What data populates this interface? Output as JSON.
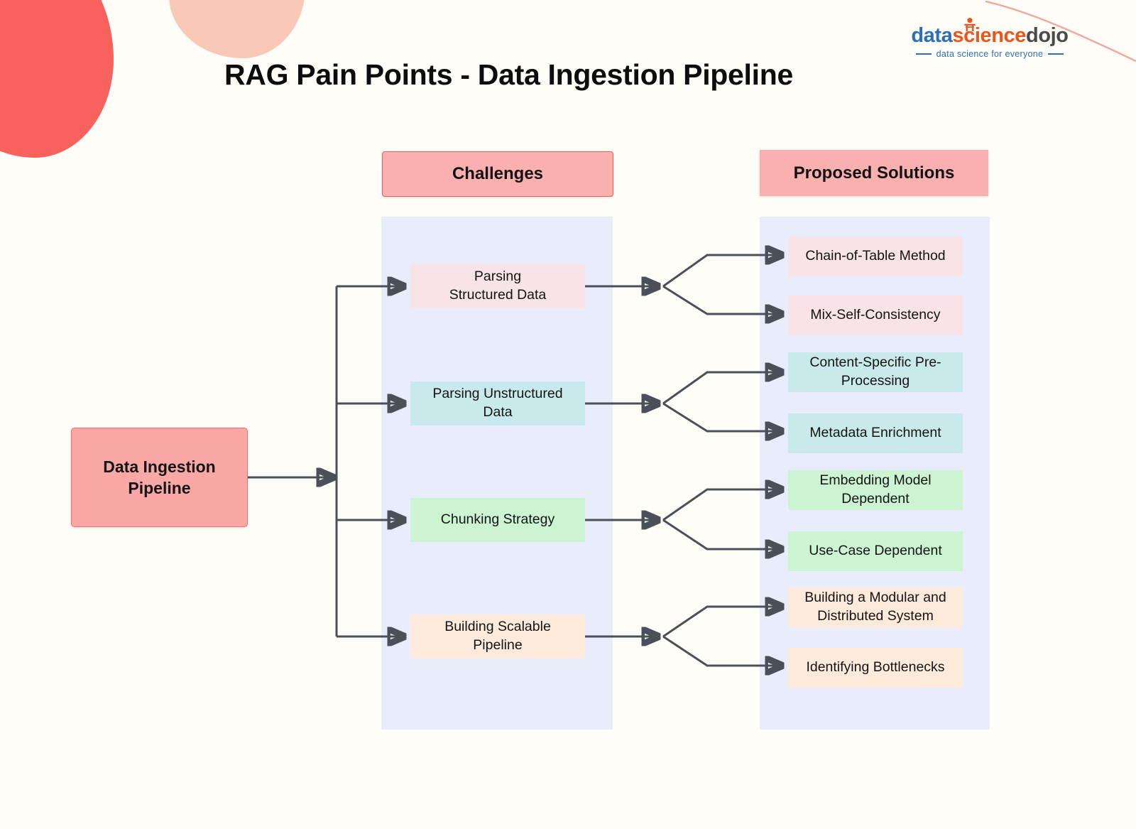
{
  "page": {
    "title": "RAG Pain Points - Data Ingestion Pipeline",
    "background_color": "#fffdf7"
  },
  "logo": {
    "part1": "data",
    "part2": "science",
    "part3": "dojo",
    "tagline": "data science for everyone",
    "colors": {
      "data": "#2d6fb7",
      "science": "#e8561d",
      "dojo": "#4a4a4a",
      "tagline": "#2d6fb7"
    }
  },
  "decorations": {
    "blob_coral_color": "#f9615d",
    "blob_peach_color": "#f9c8b7",
    "arc_color": "#f0a9a0"
  },
  "columns": {
    "challenges_header": "Challenges",
    "solutions_header": "Proposed Solutions",
    "header_color": "#f9b0ae",
    "panel_color": "#e9ecfb"
  },
  "root": {
    "label": "Data Ingestion Pipeline",
    "line1": "Data Ingestion",
    "line2": "Pipeline",
    "color": "#f9a8a6",
    "border_color": "#ef706d"
  },
  "challenges": [
    {
      "id": "parsing-structured-data",
      "label": "Parsing Structured Data",
      "line1": "Parsing",
      "line2": "Structured Data",
      "color": "#f8e3e6"
    },
    {
      "id": "parsing-unstructured-data",
      "label": "Parsing Unstructured Data",
      "line1": "Parsing Unstructured",
      "line2": "Data",
      "color": "#c9eaea"
    },
    {
      "id": "chunking-strategy",
      "label": "Chunking Strategy",
      "line1": "Chunking Strategy",
      "line2": "",
      "color": "#ccf4d3"
    },
    {
      "id": "building-scalable-pipeline",
      "label": "Building Scalable Pipeline",
      "line1": "Building Scalable",
      "line2": "Pipeline",
      "color": "#fdeadb"
    }
  ],
  "solutions": [
    {
      "id": "chain-of-table-method",
      "label": "Chain-of-Table Method",
      "line1": "Chain-of-Table Method",
      "line2": "",
      "color": "#f8e3e6",
      "parent": "parsing-structured-data"
    },
    {
      "id": "mix-self-consistency",
      "label": "Mix-Self-Consistency",
      "line1": "Mix-Self-Consistency",
      "line2": "",
      "color": "#f8e3e6",
      "parent": "parsing-structured-data"
    },
    {
      "id": "content-specific-pre-processing",
      "label": "Content-Specific Pre-Processing",
      "line1": "Content-Specific Pre-",
      "line2": "Processing",
      "color": "#c9eaea",
      "parent": "parsing-unstructured-data"
    },
    {
      "id": "metadata-enrichment",
      "label": "Metadata Enrichment",
      "line1": "Metadata Enrichment",
      "line2": "",
      "color": "#c9eaea",
      "parent": "parsing-unstructured-data"
    },
    {
      "id": "embedding-model-dependent",
      "label": "Embedding Model Dependent",
      "line1": "Embedding Model",
      "line2": "Dependent",
      "color": "#ccf4d3",
      "parent": "chunking-strategy"
    },
    {
      "id": "use-case-dependent",
      "label": "Use-Case Dependent",
      "line1": "Use-Case Dependent",
      "line2": "",
      "color": "#ccf4d3",
      "parent": "chunking-strategy"
    },
    {
      "id": "building-modular-distributed-system",
      "label": "Building a Modular and Distributed System",
      "line1": "Building a Modular and",
      "line2": "Distributed System",
      "color": "#fdeadb",
      "parent": "building-scalable-pipeline"
    },
    {
      "id": "identifying-bottlenecks",
      "label": "Identifying Bottlenecks",
      "line1": "Identifying Bottlenecks",
      "line2": "",
      "color": "#fdeadb",
      "parent": "building-scalable-pipeline"
    }
  ],
  "connectors": {
    "color": "#4b4f58",
    "stroke_width": 3
  }
}
